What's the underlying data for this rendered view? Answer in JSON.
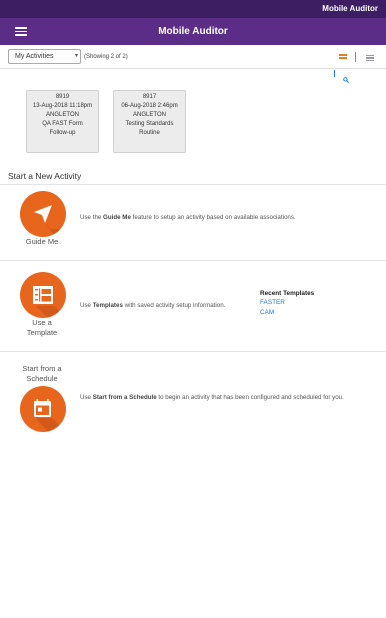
{
  "statusbar": {
    "brand": "Mobile Auditor"
  },
  "header": {
    "title": "Mobile Auditor"
  },
  "toolbar": {
    "filter_selected": "My Activities",
    "showing_text": "(Showing 2 of 2)"
  },
  "activities": [
    {
      "id": "8919",
      "date": "13-Aug-2018 11:18pm",
      "site": "ANGLETON",
      "form": "QA FAST Form",
      "type": "Follow-up"
    },
    {
      "id": "8917",
      "date": "06-Aug-2018 2:46pm",
      "site": "ANGLETON",
      "form": "Testing Standards",
      "type": "Routine"
    }
  ],
  "new_activity": {
    "title": "Start a New Activity",
    "guide": {
      "caption": "Guide Me",
      "pre": "Use the ",
      "bold": "Guide Me",
      "post": " feature to setup an activity based on available associations."
    },
    "template": {
      "caption_line1": "Use a",
      "caption_line2": "Template",
      "pre": "Use ",
      "bold": "Templates",
      "post": " with saved activity setup information."
    },
    "schedule": {
      "caption_line1": "Start from a",
      "caption_line2": "Schedule",
      "pre": "Use ",
      "bold": "Start from a Schedule",
      "post": " to begin an activity that has been configured and scheduled for you."
    }
  },
  "recent_templates": {
    "title": "Recent Templates",
    "items": [
      "FASTER",
      "CAM"
    ]
  },
  "colors": {
    "statusbar": "#3d1e63",
    "appbar": "#5b2d86",
    "accent": "#e8651c",
    "link": "#1e78d2"
  }
}
